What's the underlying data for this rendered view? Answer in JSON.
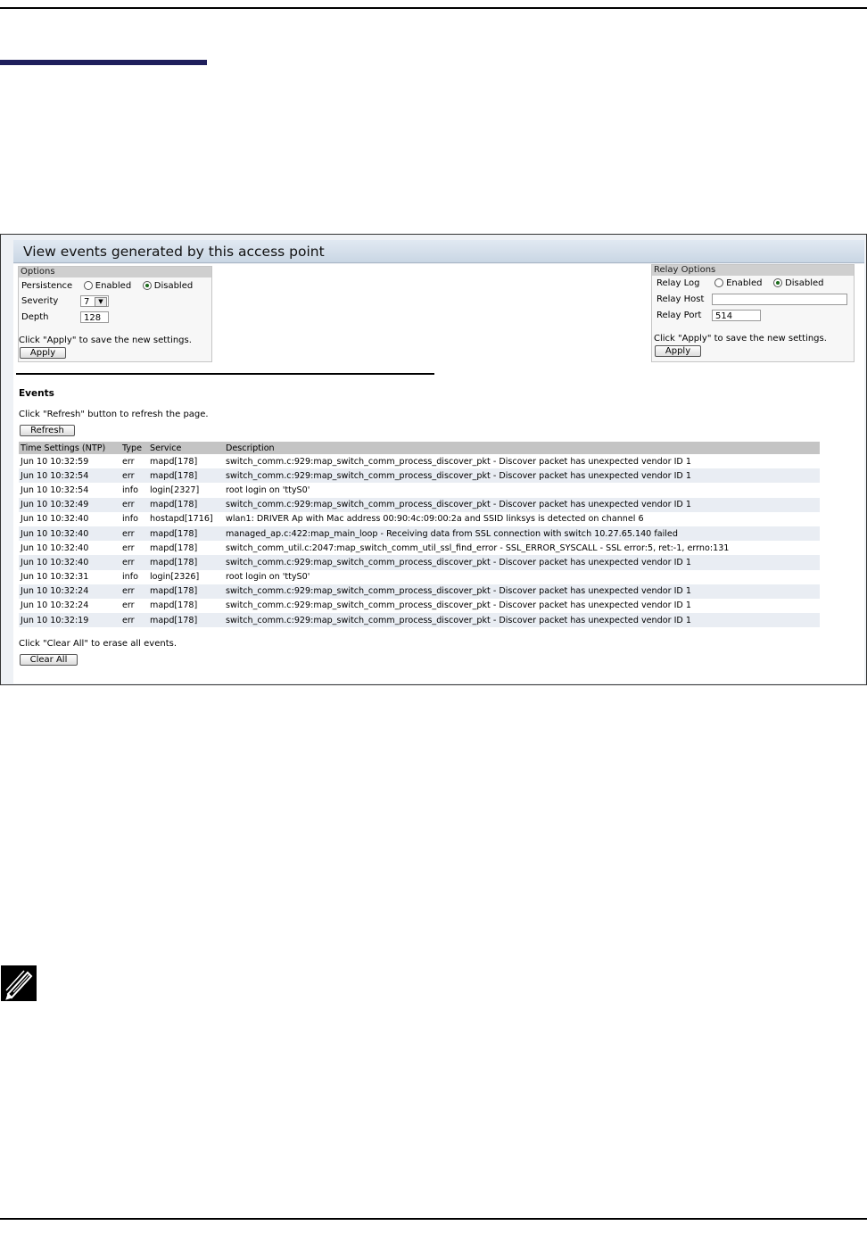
{
  "header": {
    "title": "View events generated by this access point"
  },
  "options": {
    "title": "Options",
    "persistence_label": "Persistence",
    "enabled_label": "Enabled",
    "disabled_label": "Disabled",
    "persistence_value": "Disabled",
    "severity_label": "Severity",
    "severity_value": "7",
    "depth_label": "Depth",
    "depth_value": "128",
    "apply_note": "Click \"Apply\" to save the new settings.",
    "apply_label": "Apply"
  },
  "relay": {
    "title": "Relay Options",
    "log_label": "Relay Log",
    "enabled_label": "Enabled",
    "disabled_label": "Disabled",
    "log_value": "Disabled",
    "host_label": "Relay Host",
    "host_value": "",
    "port_label": "Relay Port",
    "port_value": "514",
    "apply_note": "Click \"Apply\" to save the new settings.",
    "apply_label": "Apply"
  },
  "events": {
    "title": "Events",
    "refresh_note": "Click \"Refresh\" button to refresh the page.",
    "refresh_label": "Refresh",
    "columns": [
      "Time Settings (NTP)",
      "Type",
      "Service",
      "Description"
    ],
    "rows": [
      [
        "Jun 10 10:32:59",
        "err",
        "mapd[178]",
        "switch_comm.c:929:map_switch_comm_process_discover_pkt - Discover packet has unexpected vendor ID 1"
      ],
      [
        "Jun 10 10:32:54",
        "err",
        "mapd[178]",
        "switch_comm.c:929:map_switch_comm_process_discover_pkt - Discover packet has unexpected vendor ID 1"
      ],
      [
        "Jun 10 10:32:54",
        "info",
        "login[2327]",
        "root login on 'ttyS0'"
      ],
      [
        "Jun 10 10:32:49",
        "err",
        "mapd[178]",
        "switch_comm.c:929:map_switch_comm_process_discover_pkt - Discover packet has unexpected vendor ID 1"
      ],
      [
        "Jun 10 10:32:40",
        "info",
        "hostapd[1716]",
        "wlan1: DRIVER Ap with Mac address 00:90:4c:09:00:2a and SSID linksys is detected on channel 6"
      ],
      [
        "Jun 10 10:32:40",
        "err",
        "mapd[178]",
        "managed_ap.c:422:map_main_loop - Receiving data from SSL connection with switch 10.27.65.140 failed"
      ],
      [
        "Jun 10 10:32:40",
        "err",
        "mapd[178]",
        "switch_comm_util.c:2047:map_switch_comm_util_ssl_find_error - SSL_ERROR_SYSCALL - SSL error:5, ret:-1, errno:131"
      ],
      [
        "Jun 10 10:32:40",
        "err",
        "mapd[178]",
        "switch_comm.c:929:map_switch_comm_process_discover_pkt - Discover packet has unexpected vendor ID 1"
      ],
      [
        "Jun 10 10:32:31",
        "info",
        "login[2326]",
        "root login on 'ttyS0'"
      ],
      [
        "Jun 10 10:32:24",
        "err",
        "mapd[178]",
        "switch_comm.c:929:map_switch_comm_process_discover_pkt - Discover packet has unexpected vendor ID 1"
      ],
      [
        "Jun 10 10:32:24",
        "err",
        "mapd[178]",
        "switch_comm.c:929:map_switch_comm_process_discover_pkt - Discover packet has unexpected vendor ID 1"
      ],
      [
        "Jun 10 10:32:19",
        "err",
        "mapd[178]",
        "switch_comm.c:929:map_switch_comm_process_discover_pkt - Discover packet has unexpected vendor ID 1"
      ]
    ],
    "clear_note": "Click \"Clear All\" to erase all events.",
    "clear_label": "Clear All"
  },
  "icons": {
    "note": "pencil-note-icon",
    "radio_selected_color": "#1a6a1a"
  }
}
